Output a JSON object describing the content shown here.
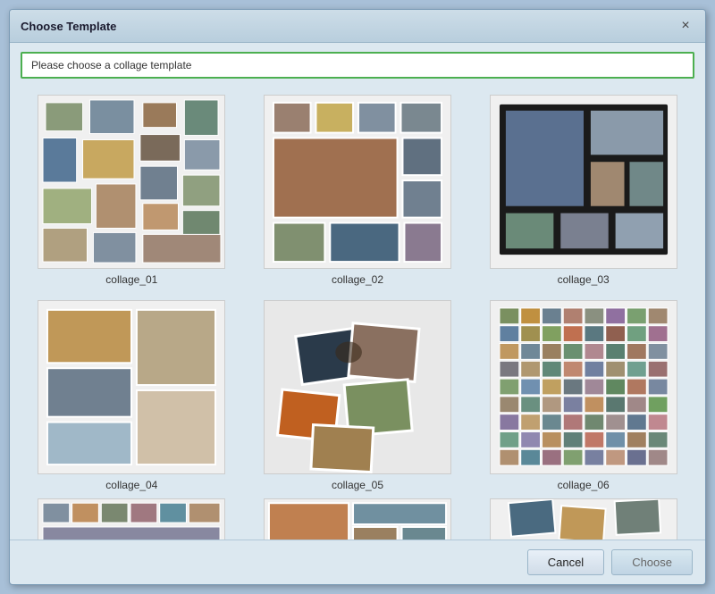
{
  "dialog": {
    "title": "Choose Template",
    "close_label": "×",
    "prompt": "Please choose a collage template"
  },
  "templates": [
    {
      "id": "collage_01",
      "name": "collage_01"
    },
    {
      "id": "collage_02",
      "name": "collage_02"
    },
    {
      "id": "collage_03",
      "name": "collage_03"
    },
    {
      "id": "collage_04",
      "name": "collage_04"
    },
    {
      "id": "collage_05",
      "name": "collage_05"
    },
    {
      "id": "collage_06",
      "name": "collage_06"
    }
  ],
  "footer": {
    "cancel_label": "Cancel",
    "choose_label": "Choose"
  }
}
